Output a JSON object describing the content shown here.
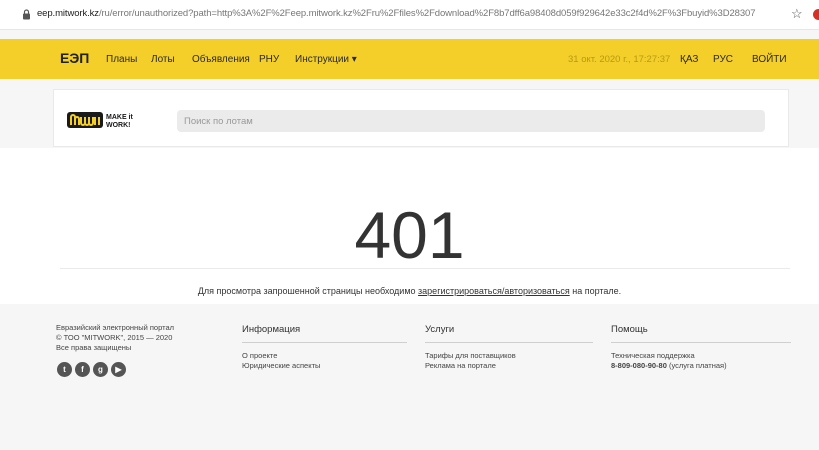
{
  "browser": {
    "url_host": "eep.mitwork.kz",
    "url_rest": "/ru/error/unauthorized?path=http%3A%2F%2Feep.mitwork.kz%2Fru%2Ffiles%2Fdownload%2F8b7dff6a98408d059f929642e33c2f4d%2F%3Fbuyid%3D28307"
  },
  "nav": {
    "brand": "ЕЭП",
    "links": [
      "Планы",
      "Лоты",
      "Объявления",
      "РНУ",
      "Инструкции ▾"
    ],
    "date": "31 окт. 2020 г., 17:27:37",
    "lang_kz": "ҚАЗ",
    "lang_ru": "РУС",
    "login": "ВОЙТИ"
  },
  "search": {
    "placeholder": "Поиск по лотам",
    "logo_text_top": "MAKE it",
    "logo_text_bottom": "WORK!"
  },
  "error": {
    "code": "401",
    "message_before": "Для просмотра запрошенной страницы необходимо",
    "message_link": "зарегистрироваться/авторизоваться",
    "message_after": "на портале."
  },
  "footer": {
    "about_lines": [
      "Евразийский электронный портал",
      "© ТОО \"MITWORK\", 2015 — 2020",
      "Все права защищены"
    ],
    "info": {
      "title": "Информация",
      "items": [
        "О проекте",
        "Юридические аспекты"
      ]
    },
    "services": {
      "title": "Услуги",
      "items": [
        "Тарифы для поставщиков",
        "Реклама на портале"
      ]
    },
    "help": {
      "title": "Помощь",
      "support_label": "Техническая поддержка",
      "phone": "8-809-080-90-80",
      "phone_note": "(услуга платная)"
    }
  },
  "icons": [
    "lock-icon",
    "star-icon",
    "twitter-icon",
    "facebook-icon",
    "google-plus-icon",
    "youtube-icon"
  ]
}
